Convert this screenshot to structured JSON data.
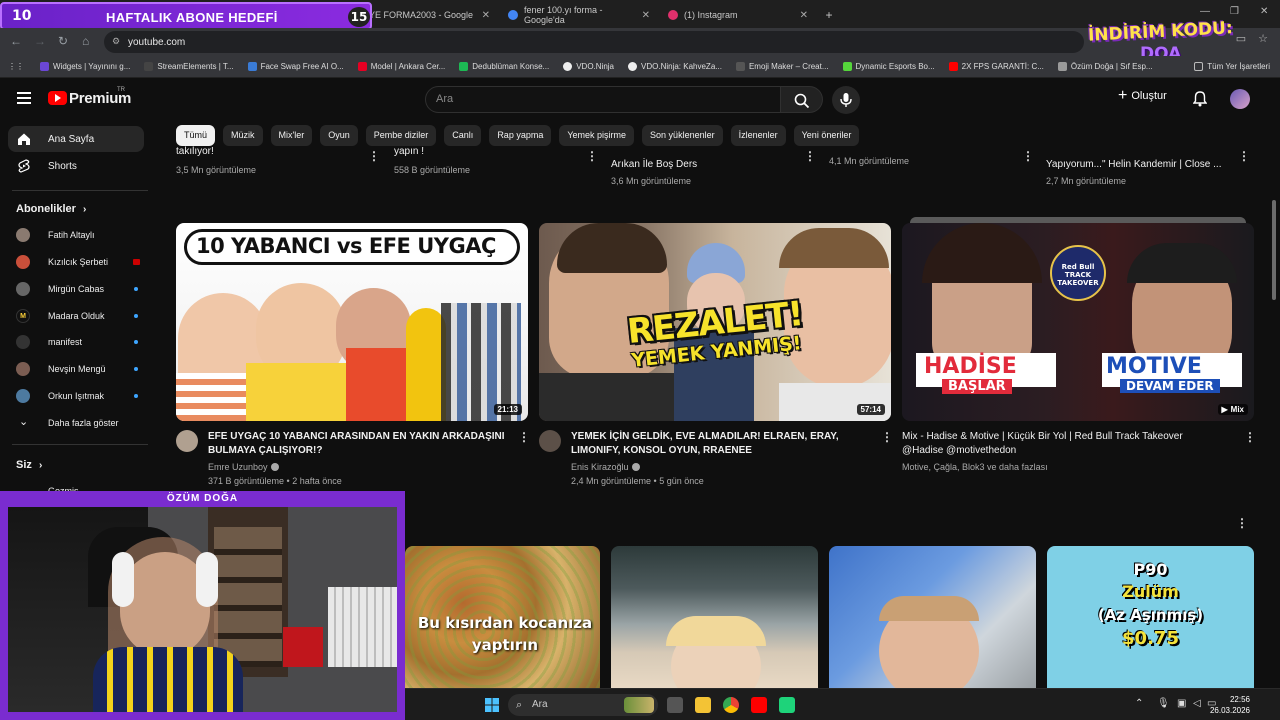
{
  "stream": {
    "goal_start": "10",
    "goal_title": "HAFTALIK ABONE HEDEFİ",
    "goal_end": "15",
    "promo_line1": "İNDİRİM KODU:",
    "promo_line2": "DOA",
    "cam_label": "ÖZÜM DOĞA"
  },
  "browser": {
    "tabs": [
      {
        "label": "RKİYE FORMA2003 - Google",
        "color": "#4285f4"
      },
      {
        "label": "fener 100.yı forma - Google'da",
        "color": "#4285f4"
      },
      {
        "label": "(1) Instagram",
        "color": "#e1306c"
      }
    ],
    "url": "youtube.com",
    "bookmarks": [
      {
        "label": "Widgets | Yayınını g...",
        "color": "#6b47d6"
      },
      {
        "label": "StreamElements | T...",
        "color": "#222"
      },
      {
        "label": "Face Swap Free AI O...",
        "color": "#3a7bd5"
      },
      {
        "label": "Model | Ankara Cer...",
        "color": "#e60023"
      },
      {
        "label": "Dedublüman Konse...",
        "color": "#1db954"
      },
      {
        "label": "VDO.Ninja",
        "color": "#eee"
      },
      {
        "label": "VDO.Ninja: KahveZa...",
        "color": "#eee"
      },
      {
        "label": "Emoji Maker – Creat...",
        "color": "#555"
      },
      {
        "label": "Dynamic Esports Bo...",
        "color": "#55d63b"
      },
      {
        "label": "2X FPS GARANTİ: C...",
        "color": "#ff0000"
      },
      {
        "label": "Özüm Doğa | Sıf Esp...",
        "color": "#9a9a9a"
      }
    ],
    "bookmarks_other": "Tüm Yer İşaretleri"
  },
  "youtube": {
    "brand": "Premium",
    "brand_sup": "TR",
    "search_placeholder": "Ara",
    "create_label": "Oluştur",
    "chips": [
      "Tümü",
      "Müzik",
      "Mix'ler",
      "Oyun",
      "Pembe diziler",
      "Canlı",
      "Rap yapma",
      "Yemek pişirme",
      "Son yüklenenler",
      "İzlenenler",
      "Yeni öneriler"
    ],
    "sidebar": {
      "home": "Ana Sayfa",
      "shorts": "Shorts",
      "subs_header": "Abonelikler",
      "subs": [
        {
          "name": "Fatih Altaylı",
          "color": "#8a7a70",
          "mark": ""
        },
        {
          "name": "Kızılcık Şerbeti",
          "color": "#c94f3a",
          "mark": "live"
        },
        {
          "name": "Mirgün Cabas",
          "color": "#555",
          "mark": "dot"
        },
        {
          "name": "Madara Olduk",
          "color": "#111",
          "mark": "dot"
        },
        {
          "name": "manifest",
          "color": "#333",
          "mark": "dot"
        },
        {
          "name": "Nevşin Mengü",
          "color": "#7b5d52",
          "mark": "dot"
        },
        {
          "name": "Orkun Işıtmak",
          "color": "#4d7aa0",
          "mark": "dot"
        }
      ],
      "show_more": "Daha fazla göster",
      "you_header": "Siz",
      "partial": "Gezmis"
    },
    "prev_row": [
      {
        "title": "takılıyor!",
        "meta": "3,5 Mn görüntüleme"
      },
      {
        "title": "yapın !",
        "meta": "558 B görüntüleme"
      },
      {
        "title": "Arıkan İle Boş Ders",
        "meta": "3,6 Mn görüntüleme"
      },
      {
        "title": "",
        "meta": "4,1 Mn görüntüleme"
      },
      {
        "title": "Yapıyorum...\" Helin Kandemir | Close ...",
        "meta": "2,7 Mn görüntüleme"
      }
    ],
    "videos": [
      {
        "title_l1": "EFE UYGAÇ 10 YABANCI ARASINDAN EN YAKIN ARKADAŞINI",
        "title_l2": "BULMAYA ÇALIŞIYOR!?",
        "channel": "Emre Uzunboy",
        "meta": "371 B görüntüleme • 2 hafta önce",
        "duration": "21:13",
        "thumb_text": "10 YABANCI vs EFE UYGAÇ"
      },
      {
        "title_l1": "YEMEK İÇİN GELDİK, EVE ALMADILAR! ELRAEN, ERAY,",
        "title_l2": "LIMONIFY, KONSOL OYUN, RRAENEE",
        "channel": "Enis Kirazoğlu",
        "meta": "2,4 Mn görüntüleme • 5 gün önce",
        "duration": "57:14",
        "thumb_text_1": "REZALET!",
        "thumb_text_2": "YEMEK YANMIŞ!"
      },
      {
        "title_l1": "Mix - Hadise & Motive | Küçük Bir Yol | Red Bull Track Takeover",
        "title_l2": "@Hadise @motivethedon",
        "channel": "Motive, Çağla, Blok3 ve daha fazlası",
        "meta": "",
        "duration": "Mix",
        "thumb_left": "HADİSE",
        "thumb_left_sub": "BAŞLAR",
        "thumb_right": "MOTIVE",
        "thumb_right_sub": "DEVAM EDER",
        "thumb_badge": "Red Bull TRACK TAKEOVER"
      }
    ],
    "shorts": [
      {
        "text_1": "Bu kısırdan kocanıza",
        "text_2": "yaptırın"
      },
      {
        "text_1": "",
        "text_2": ""
      },
      {
        "text_1": "",
        "text_2": ""
      },
      {
        "text_1": "P90",
        "text_2": "Zulüm",
        "text_3": "(Az Aşınmış)",
        "text_4": "$0.75"
      }
    ]
  },
  "taskbar": {
    "search": "Ara",
    "time": "22:56",
    "date": "26.03.2026"
  }
}
